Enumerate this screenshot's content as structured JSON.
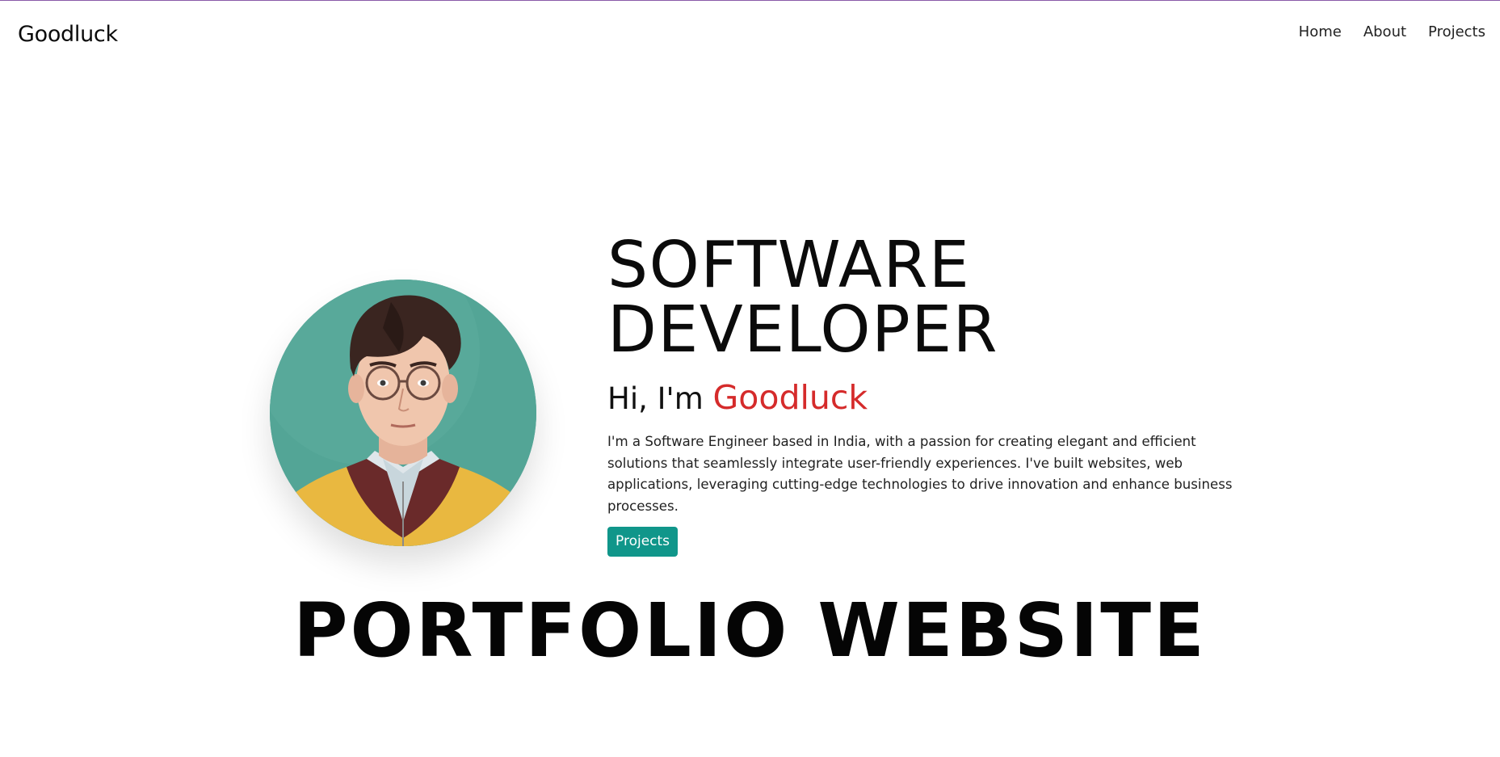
{
  "nav": {
    "brand": "Goodluck",
    "links": [
      "Home",
      "About",
      "Projects"
    ]
  },
  "hero": {
    "headline_line1": "SOFTWARE",
    "headline_line2": "DEVELOPER",
    "greeting_prefix": "Hi, I'm",
    "greeting_name": "Goodluck",
    "bio": "I'm a Software Engineer based in India, with a passion for creating elegant and efficient solutions that seamlessly integrate user-friendly experiences. I've built websites, web applications, leveraging cutting-edge technologies to drive innovation and enhance business processes.",
    "cta_label": "Projects"
  },
  "banner": {
    "title": "PORTFOLIO WEBSITE"
  },
  "colors": {
    "accent_name": "#d52b2b",
    "button_bg": "#10968a",
    "avatar_bg": "#53a596",
    "top_rule": "#8a5aa8"
  }
}
